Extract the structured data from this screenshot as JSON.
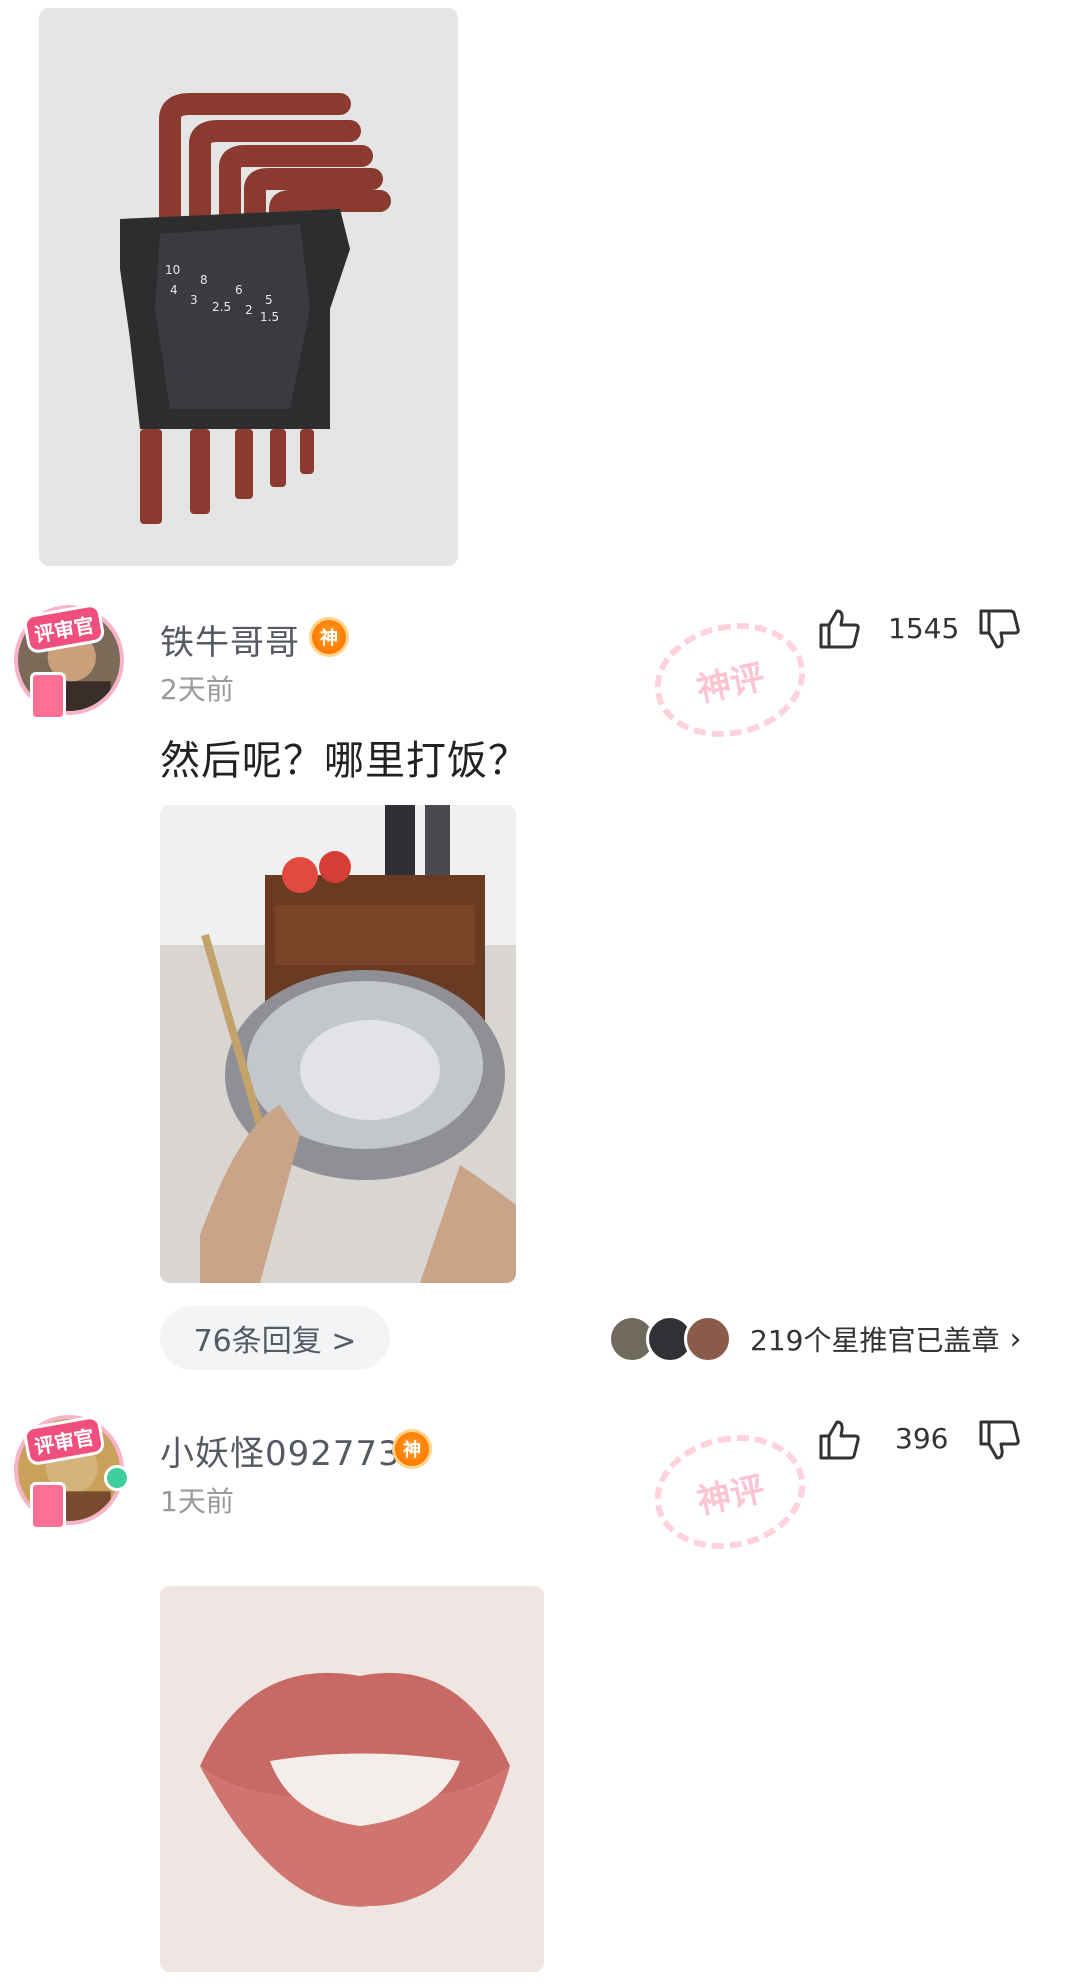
{
  "comments": [
    {
      "username": "铁牛哥哥",
      "badge": "神",
      "avatar_badge": "评审官",
      "time": "2天前",
      "likes": "1545",
      "stamp": "神评",
      "text": "然后呢？哪里打饭？",
      "replies_label": "76条回复 >",
      "stamped_label": "219个星推官已盖章",
      "chevron": "›"
    },
    {
      "username": "小妖怪092773",
      "badge": "神",
      "avatar_badge": "评审官",
      "time": "1天前",
      "likes": "396",
      "stamp": "神评"
    }
  ],
  "top_image": {
    "labels": [
      "10",
      "8",
      "6",
      "5",
      "4",
      "3",
      "2.5",
      "2",
      "1.5"
    ]
  },
  "colors": {
    "accent_pink": "#f04f7e",
    "god_badge": "#ff7a00",
    "online": "#3ccf9b"
  },
  "icons": [
    "thumb-up-icon",
    "thumb-down-icon",
    "chevron-right-icon"
  ]
}
